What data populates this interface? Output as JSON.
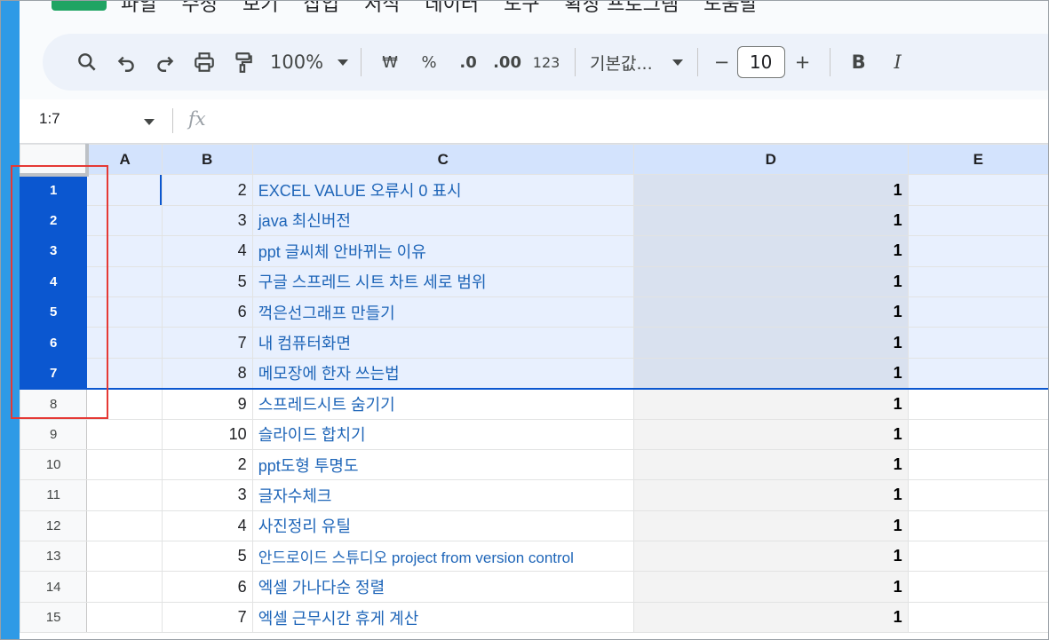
{
  "menu": {
    "items": [
      "파일",
      "수정",
      "보기",
      "삽입",
      "서식",
      "데이터",
      "도구",
      "확장 프로그램",
      "도움말"
    ]
  },
  "toolbar": {
    "zoom": "100%",
    "currency": "₩",
    "percent": "%",
    "decimal_decrease": ".0",
    "decimal_increase": ".00",
    "number_format": "123",
    "font": "기본값...",
    "font_size": "10",
    "minus": "−",
    "plus": "+",
    "bold": "B",
    "italic": "I"
  },
  "formula_bar": {
    "name_box": "1:7",
    "fx": "fx"
  },
  "columns": [
    "A",
    "B",
    "C",
    "D",
    "E"
  ],
  "rows": [
    {
      "n": "1",
      "b": "2",
      "c": "EXCEL VALUE 오류시 0 표시",
      "d": "1"
    },
    {
      "n": "2",
      "b": "3",
      "c": "java 최신버전",
      "d": "1"
    },
    {
      "n": "3",
      "b": "4",
      "c": "ppt 글씨체 안바뀌는 이유",
      "d": "1"
    },
    {
      "n": "4",
      "b": "5",
      "c": "구글 스프레드 시트 차트 세로 범위",
      "d": "1"
    },
    {
      "n": "5",
      "b": "6",
      "c": "꺽은선그래프 만들기",
      "d": "1"
    },
    {
      "n": "6",
      "b": "7",
      "c": "내 컴퓨터화면",
      "d": "1"
    },
    {
      "n": "7",
      "b": "8",
      "c": "메모장에 한자 쓰는법",
      "d": "1"
    },
    {
      "n": "8",
      "b": "9",
      "c": "스프레드시트 숨기기",
      "d": "1"
    },
    {
      "n": "9",
      "b": "10",
      "c": "슬라이드 합치기",
      "d": "1"
    },
    {
      "n": "10",
      "b": "2",
      "c": "ppt도형 투명도",
      "d": "1"
    },
    {
      "n": "11",
      "b": "3",
      "c": "글자수체크",
      "d": "1"
    },
    {
      "n": "12",
      "b": "4",
      "c": "사진정리 유틸",
      "d": "1"
    },
    {
      "n": "13",
      "b": "5",
      "c": "안드로이드 스튜디오 project from version control",
      "d": "1"
    },
    {
      "n": "14",
      "b": "6",
      "c": "엑셀 가나다순 정렬",
      "d": "1"
    },
    {
      "n": "15",
      "b": "7",
      "c": "엑셀 근무시간 휴게 계산",
      "d": "1"
    }
  ],
  "colors": {
    "selection": "#0b57d0",
    "selected_fill": "#e8f0fe",
    "annotation": "#e53935",
    "frame_accent": "#2e9ae6"
  }
}
